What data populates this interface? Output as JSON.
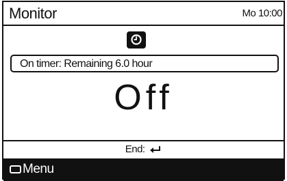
{
  "header": {
    "title": "Monitor",
    "clock": "Mo 10:00"
  },
  "timer": {
    "icon": "clock-icon",
    "message": "On timer: Remaining  6.0 hour"
  },
  "status": {
    "value": "Off"
  },
  "footer": {
    "end_label": "End:",
    "end_icon": "enter-return-icon",
    "menu_icon": "menu-button-icon",
    "menu_label": "Menu"
  }
}
